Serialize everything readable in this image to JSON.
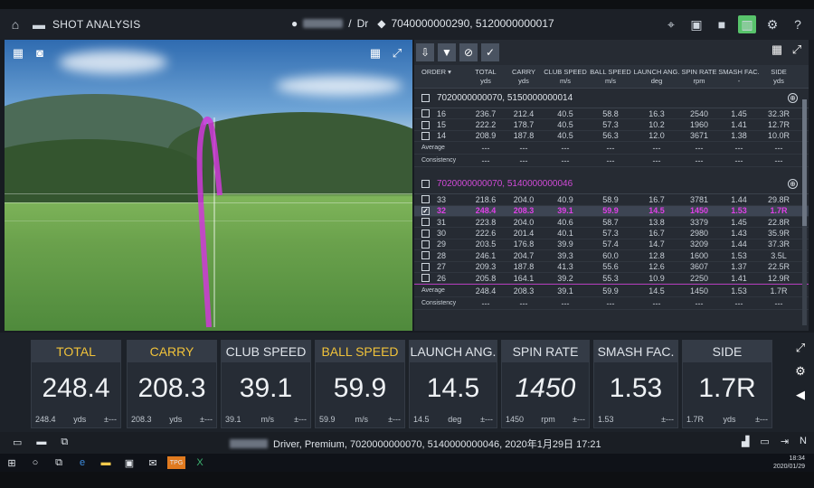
{
  "app": {
    "title": "SHOT ANALYSIS",
    "player_club": "Dr",
    "shot_ids": "7040000000290, 5120000000017"
  },
  "table": {
    "headers": [
      {
        "name": "ORDER",
        "unit": ""
      },
      {
        "name": "TOTAL",
        "unit": "yds"
      },
      {
        "name": "CARRY",
        "unit": "yds"
      },
      {
        "name": "CLUB SPEED",
        "unit": "m/s"
      },
      {
        "name": "BALL SPEED",
        "unit": "m/s"
      },
      {
        "name": "LAUNCH ANG.",
        "unit": "deg"
      },
      {
        "name": "SPIN RATE",
        "unit": "rpm"
      },
      {
        "name": "SMASH FAC.",
        "unit": "-"
      },
      {
        "name": "SIDE",
        "unit": "yds"
      }
    ],
    "group1": {
      "title": "7020000000070, 5150000000014",
      "rows": [
        [
          "16",
          "236.7",
          "212.4",
          "40.5",
          "58.8",
          "16.3",
          "2540",
          "1.45",
          "32.3R"
        ],
        [
          "15",
          "222.2",
          "178.7",
          "40.5",
          "57.3",
          "10.2",
          "1960",
          "1.41",
          "12.7R"
        ],
        [
          "14",
          "208.9",
          "187.8",
          "40.5",
          "56.3",
          "12.0",
          "3671",
          "1.38",
          "10.0R"
        ]
      ],
      "average_label": "Average",
      "consistency_label": "Consistency",
      "average": [
        "---",
        "---",
        "---",
        "---",
        "---",
        "---",
        "---",
        "---"
      ],
      "consistency": [
        "---",
        "---",
        "---",
        "---",
        "---",
        "---",
        "---",
        "---"
      ]
    },
    "group2": {
      "title": "7020000000070, 5140000000046",
      "rows": [
        [
          "33",
          "218.6",
          "204.0",
          "40.9",
          "58.9",
          "16.7",
          "3781",
          "1.44",
          "29.8R"
        ],
        [
          "32",
          "248.4",
          "208.3",
          "39.1",
          "59.9",
          "14.5",
          "1450",
          "1.53",
          "1.7R"
        ],
        [
          "31",
          "223.8",
          "204.0",
          "40.6",
          "58.7",
          "13.8",
          "3379",
          "1.45",
          "22.8R"
        ],
        [
          "30",
          "222.6",
          "201.4",
          "40.1",
          "57.3",
          "16.7",
          "2980",
          "1.43",
          "35.9R"
        ],
        [
          "29",
          "203.5",
          "176.8",
          "39.9",
          "57.4",
          "14.7",
          "3209",
          "1.44",
          "37.3R"
        ],
        [
          "28",
          "246.1",
          "204.7",
          "39.3",
          "60.0",
          "12.8",
          "1600",
          "1.53",
          "3.5L"
        ],
        [
          "27",
          "209.3",
          "187.8",
          "41.3",
          "55.6",
          "12.6",
          "3607",
          "1.37",
          "22.5R"
        ],
        [
          "26",
          "205.8",
          "164.1",
          "39.2",
          "55.3",
          "10.9",
          "2250",
          "1.41",
          "12.9R"
        ]
      ],
      "average_label": "Average",
      "consistency_label": "Consistency",
      "average": [
        "248.4",
        "208.3",
        "39.1",
        "59.9",
        "14.5",
        "1450",
        "1.53",
        "1.7R"
      ],
      "consistency": [
        "---",
        "---",
        "---",
        "---",
        "---",
        "---",
        "---",
        "---"
      ]
    }
  },
  "metrics": [
    {
      "label": "TOTAL",
      "gold": true,
      "value": "248.4",
      "sub_value": "248.4",
      "unit": "yds",
      "dev": "±---",
      "italic": false
    },
    {
      "label": "CARRY",
      "gold": true,
      "value": "208.3",
      "sub_value": "208.3",
      "unit": "yds",
      "dev": "±---",
      "italic": false
    },
    {
      "label": "CLUB SPEED",
      "gold": false,
      "value": "39.1",
      "sub_value": "39.1",
      "unit": "m/s",
      "dev": "±---",
      "italic": false
    },
    {
      "label": "BALL SPEED",
      "gold": true,
      "value": "59.9",
      "sub_value": "59.9",
      "unit": "m/s",
      "dev": "±---",
      "italic": false
    },
    {
      "label": "LAUNCH ANG.",
      "gold": false,
      "value": "14.5",
      "sub_value": "14.5",
      "unit": "deg",
      "dev": "±---",
      "italic": false
    },
    {
      "label": "SPIN RATE",
      "gold": false,
      "value": "1450",
      "sub_value": "1450",
      "unit": "rpm",
      "dev": "±---",
      "italic": true
    },
    {
      "label": "SMASH FAC.",
      "gold": false,
      "value": "1.53",
      "sub_value": "1.53",
      "unit": "",
      "dev": "±---",
      "italic": false
    },
    {
      "label": "SIDE",
      "gold": false,
      "value": "1.7R",
      "sub_value": "1.7R",
      "unit": "yds",
      "dev": "±---",
      "italic": false
    }
  ],
  "status": {
    "session_info": "Driver, Premium, 7020000000070, 5140000000046, 2020年1月29日 17:21"
  },
  "taskbar": {
    "time": "18:34",
    "date": "2020/01/29",
    "app_label": "TPG"
  },
  "colors": {
    "accent_gold": "#f0c23a",
    "highlight_pink": "#d14ad8",
    "active_tool": "#58c36b"
  }
}
